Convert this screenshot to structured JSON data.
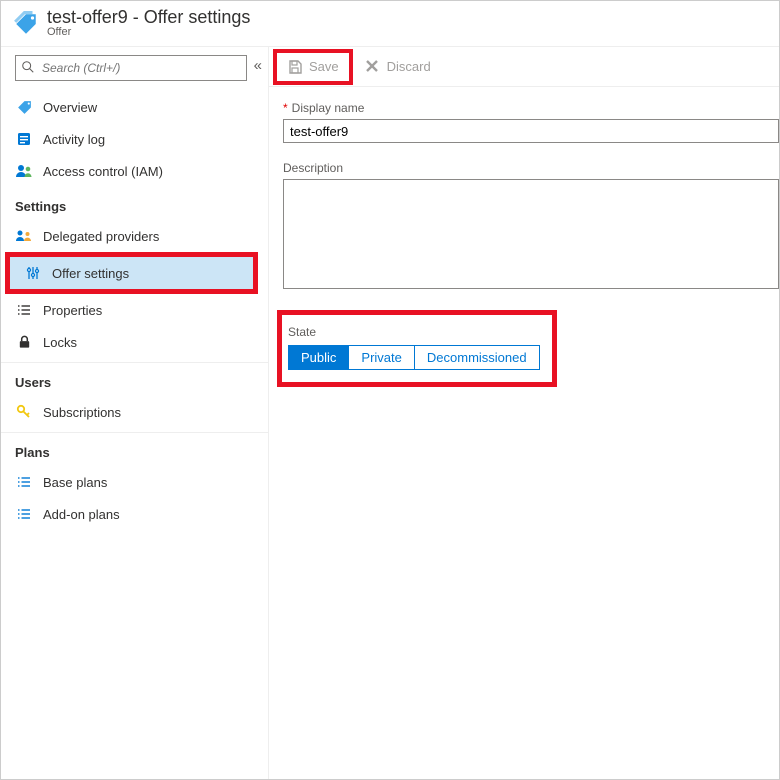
{
  "header": {
    "title": "test-offer9 - Offer settings",
    "subtitle": "Offer"
  },
  "search": {
    "placeholder": "Search (Ctrl+/)"
  },
  "nav": {
    "overview": "Overview",
    "activity_log": "Activity log",
    "access_control": "Access control (IAM)",
    "section_settings": "Settings",
    "delegated_providers": "Delegated providers",
    "offer_settings": "Offer settings",
    "properties": "Properties",
    "locks": "Locks",
    "section_users": "Users",
    "subscriptions": "Subscriptions",
    "section_plans": "Plans",
    "base_plans": "Base plans",
    "addon_plans": "Add-on plans"
  },
  "toolbar": {
    "save": "Save",
    "discard": "Discard"
  },
  "form": {
    "display_name_label": "Display name",
    "display_name_value": "test-offer9",
    "description_label": "Description",
    "description_value": "",
    "state_label": "State",
    "state_public": "Public",
    "state_private": "Private",
    "state_decommissioned": "Decommissioned"
  }
}
